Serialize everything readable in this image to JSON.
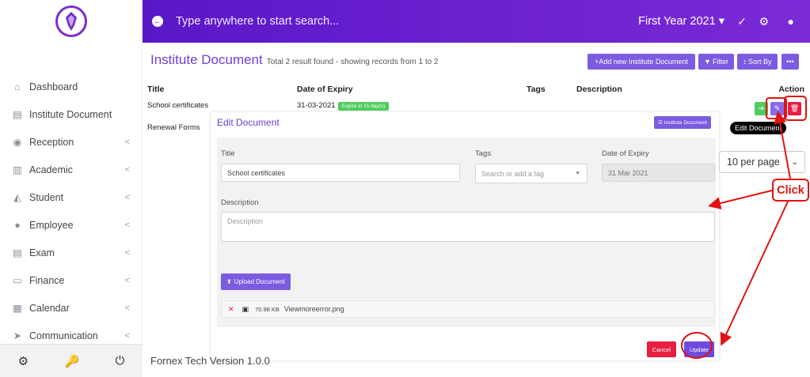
{
  "sidebar": {
    "items": [
      {
        "label": "Dashboard",
        "icon": "home-icon",
        "chevron": false
      },
      {
        "label": "Institute Document",
        "icon": "file-icon",
        "chevron": false
      },
      {
        "label": "Reception",
        "icon": "user-circle-icon",
        "chevron": true
      },
      {
        "label": "Academic",
        "icon": "school-icon",
        "chevron": true
      },
      {
        "label": "Student",
        "icon": "graduation-cap-icon",
        "chevron": true
      },
      {
        "label": "Employee",
        "icon": "employee-icon",
        "chevron": true
      },
      {
        "label": "Exam",
        "icon": "file-icon",
        "chevron": true
      },
      {
        "label": "Finance",
        "icon": "money-icon",
        "chevron": true
      },
      {
        "label": "Calendar",
        "icon": "calendar-icon",
        "chevron": true
      },
      {
        "label": "Communication",
        "icon": "send-icon",
        "chevron": true
      }
    ],
    "chevron_glyph": "<"
  },
  "topbar": {
    "search_placeholder": "Type anywhere to start search...",
    "year": "First Year 2021"
  },
  "page": {
    "title": "Institute Document",
    "subtitle": "Total 2 result found - showing records from 1 to 2",
    "add_button": "+Add new Institute Document",
    "filter_button": "Filter",
    "sort_button": "Sort By",
    "more_button": "•••"
  },
  "table": {
    "headers": {
      "title": "Title",
      "expiry": "Date of Expiry",
      "tags": "Tags",
      "description": "Description",
      "action": "Action"
    },
    "rows": [
      {
        "title": "School certificates",
        "expiry": "31-03-2021",
        "badge": "Expire in 15 day(s)"
      },
      {
        "title": "Renewal Forms"
      }
    ]
  },
  "modal": {
    "title": "Edit Document",
    "list_button": "Institute Document",
    "labels": {
      "title": "Title",
      "tags": "Tags",
      "expiry": "Date of Expiry",
      "description": "Description"
    },
    "values": {
      "title": "School certificates",
      "expiry": "31 Mar 2021"
    },
    "placeholders": {
      "tags": "Search or add a tag",
      "description": "Description"
    },
    "upload_button": "Upload Document",
    "file": {
      "size": "70.98 KB",
      "name": "Viewmoreerror.png"
    },
    "cancel_button": "Cancel",
    "update_button": "Update"
  },
  "tooltip": "Edit Document",
  "per_page": "10 per page",
  "footer": "Fornex Tech Version 1.0.0",
  "annotation": {
    "label": "Click",
    "color": "#e21212"
  },
  "colors": {
    "accent": "#7b5be0",
    "topbar": "#5a17c8",
    "danger": "#e81d42",
    "success": "#4fce5d"
  }
}
